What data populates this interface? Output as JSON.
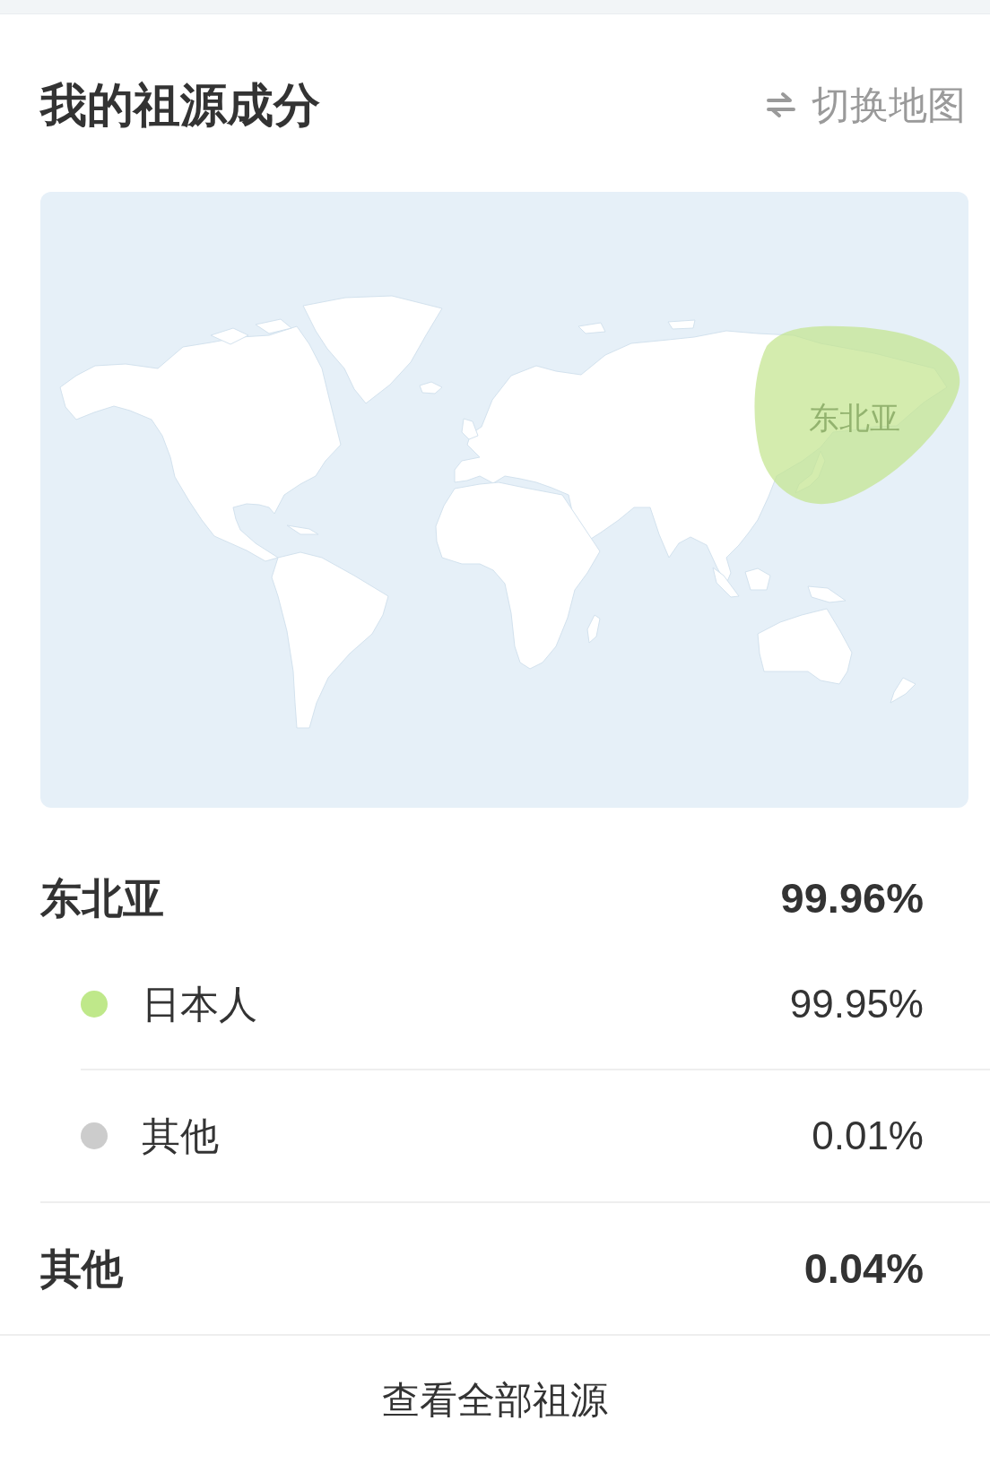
{
  "header": {
    "title": "我的祖源成分",
    "switch_button": "切换地图"
  },
  "map": {
    "highlight": {
      "label": "东北亚"
    }
  },
  "ancestry": [
    {
      "name": "东北亚",
      "percent": "99.96%",
      "children": [
        {
          "name": "日本人",
          "percent": "99.95%",
          "color": "#bfe88a"
        },
        {
          "name": "其他",
          "percent": "0.01%",
          "color": "#cccccc"
        }
      ]
    },
    {
      "name": "其他",
      "percent": "0.04%"
    }
  ],
  "footer": {
    "button": "查看全部祖源"
  }
}
